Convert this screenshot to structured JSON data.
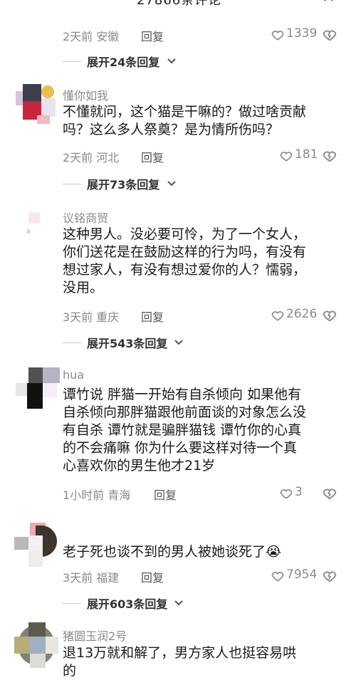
{
  "header": {
    "title": "27866条评论",
    "dash": "—",
    "close": "✕"
  },
  "comments": [
    {
      "meta": {
        "time": "2天前 安徽",
        "reply": "回复"
      },
      "likes": "1339",
      "expand": "展开24条回复"
    },
    {
      "username": "懂你如我",
      "lines": [
        "不懂就问，这个猫是干嘛的？做过啥贡献",
        "吗？这么多人祭奠？是为情所伤吗？"
      ],
      "meta": {
        "time": "2天前 河北",
        "reply": "回复"
      },
      "likes": "181",
      "expand": "展开73条回复"
    },
    {
      "username": "议铭商贸",
      "lines": [
        "这种男人。没必要可怜，为了一个女人，",
        "你们送花是在鼓励这样的行为吗，有没有",
        "想过家人，有没有想过爱你的人？懦弱，",
        "没用。"
      ],
      "meta": {
        "time": "3天前 重庆",
        "reply": "回复"
      },
      "likes": "2626",
      "expand": "展开543条回复"
    },
    {
      "username": "hua",
      "lines": [
        "谭竹说 胖猫一开始有自杀倾向 如果他有",
        "自杀倾向那胖猫跟他前面谈的对象怎么没",
        "有自杀 谭竹就是骗胖猫钱 谭竹你的心真",
        "的不会痛嘛 你为什么要这样对待一个真",
        "心喜欢你的男生他才21岁"
      ],
      "meta": {
        "time": "1小时前 青海",
        "reply": "回复"
      },
      "likes": "3"
    },
    {
      "lines": [
        "老子死也谈不到的男人被她谈死了"
      ],
      "emoji": "😭",
      "meta": {
        "time": "3天前 福建",
        "reply": "回复"
      },
      "likes": "7954",
      "expand": "展开603条回复"
    },
    {
      "username": "猪圆玉润2号",
      "lines": [
        "退13万就和解了，男方家人也挺容易哄",
        "的"
      ]
    }
  ],
  "colors": {
    "meta": "#8a8a8a",
    "text": "#1a1a1a",
    "expand": "#333333"
  }
}
